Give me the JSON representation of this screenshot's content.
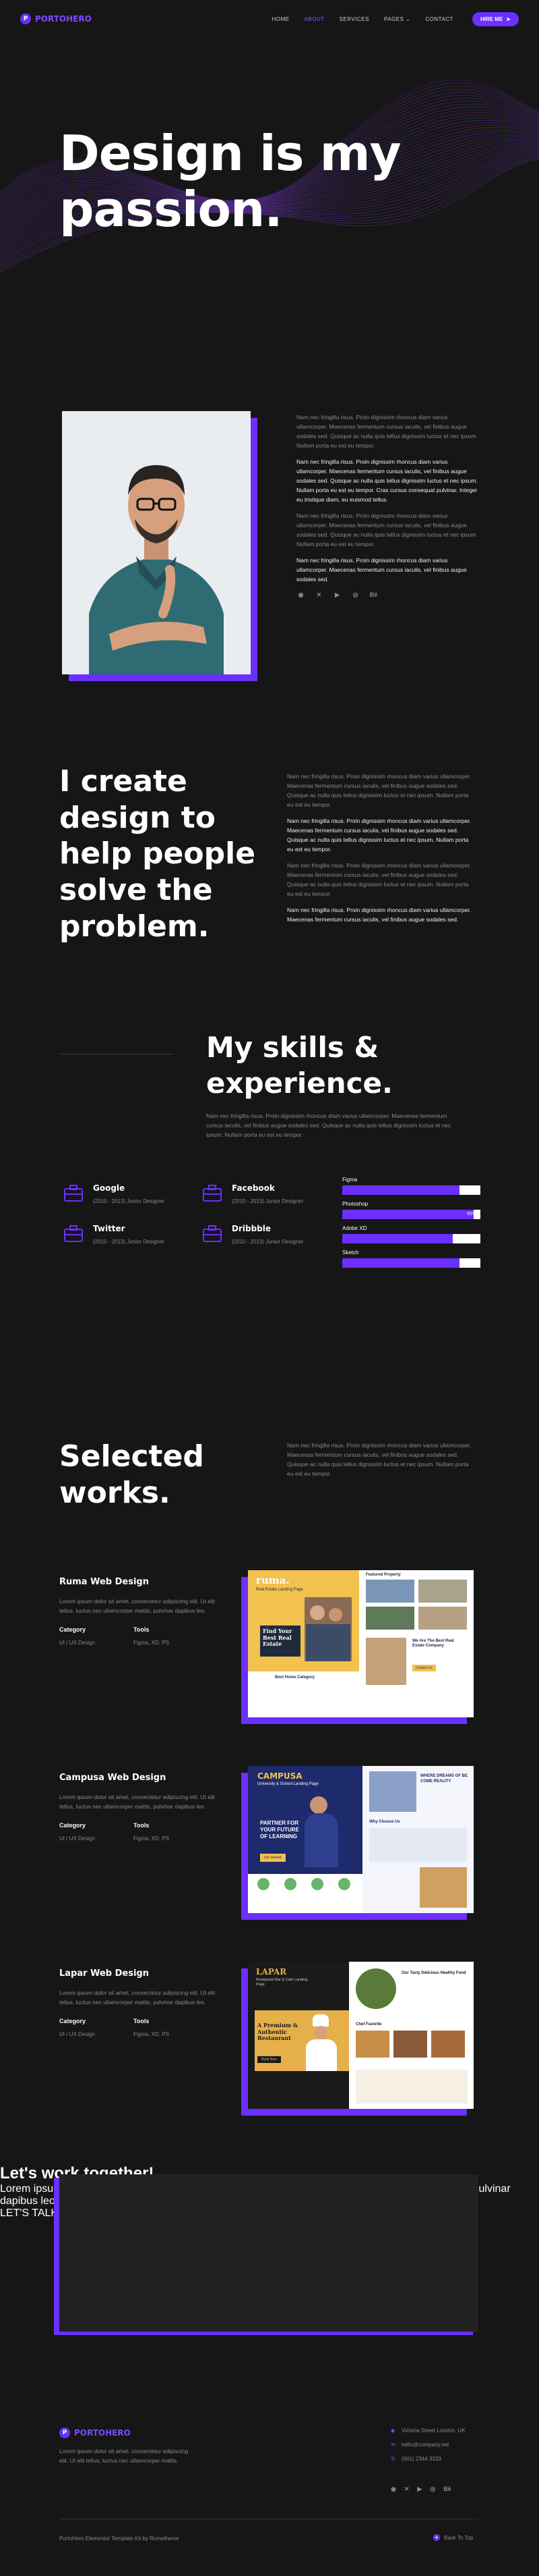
{
  "brand": {
    "name": "PORTOHERO",
    "mark": "P",
    "accent": "#6b2fff"
  },
  "nav": {
    "items": [
      {
        "label": "HOME"
      },
      {
        "label": "ABOUT",
        "active": true
      },
      {
        "label": "SERVICES"
      },
      {
        "label": "PAGES",
        "dropdown": true
      },
      {
        "label": "CONTACT"
      }
    ],
    "cta": "HIRE ME"
  },
  "hero": {
    "title": "Design is my passion."
  },
  "about": {
    "paragraphs": [
      {
        "text": "Nam nec fringilla risus. Proin dignissim rhoncus diam varius ullamcorper. Maecenas fermentum cursus iaculis, vel finibus augue sodales sed. Quisque ac nulla quis tellus dignissim luctus et nec ipsum. Nullam porta eu est eu tempor.",
        "style": "muted"
      },
      {
        "text": "Nam nec fringilla risus. Proin dignissim rhoncus diam varius ullamcorper. Maecenas fermentum cursus iaculis, vel finibus augue sodales sed. Quisque ac nulla quis tellus dignissim luctus et nec ipsum. Nullam porta eu est eu tempor. Cras cursus consequat pulvinar. Integer eu tristique diam, eu euismod tellus.",
        "style": "bright"
      },
      {
        "text": "Nam nec fringilla risus. Proin dignissim rhoncus diam varius ullamcorper. Maecenas fermentum cursus iaculis, vel finibus augue sodales sed. Quisque ac nulla quis tellus dignissim luctus et nec ipsum. Nullam porta eu est eu tempor.",
        "style": "muted"
      },
      {
        "text": "Nam nec fringilla risus. Proin dignissim rhoncus diam varius ullamcorper. Maecenas fermentum cursus iaculis, vel finibus augue sodales sed.",
        "style": "bright"
      }
    ],
    "socials": [
      {
        "icon": "github-icon",
        "glyph": "◉"
      },
      {
        "icon": "twitter-icon",
        "glyph": "✕"
      },
      {
        "icon": "youtube-icon",
        "glyph": "▶"
      },
      {
        "icon": "dribbble-icon",
        "glyph": "◎"
      },
      {
        "icon": "behance-icon",
        "glyph": "Bē"
      }
    ]
  },
  "create": {
    "title": "I create design to help people solve the problem.",
    "paragraphs": [
      {
        "text": "Nam nec fringilla risus. Proin dignissim rhoncus diam varius ullamcorper. Maecenas fermentum cursus iaculis, vel finibus augue sodales sed. Quisque ac nulla quis tellus dignissim luctus et nec ipsum. Nullam porta eu est eu tempor.",
        "style": "muted"
      },
      {
        "text": "Nam nec fringilla risus. Proin dignissim rhoncus diam varius ullamcorper. Maecenas fermentum cursus iaculis, vel finibus augue sodales sed. Quisque ac nulla quis tellus dignissim luctus et nec ipsum. Nullam porta eu est eu tempor.",
        "style": "bright"
      },
      {
        "text": "Nam nec fringilla risus. Proin dignissim rhoncus diam varius ullamcorper. Maecenas fermentum cursus iaculis, vel finibus augue sodales sed. Quisque ac nulla quis tellus dignissim luctus et nec ipsum. Nullam porta eu est eu tempor.",
        "style": "muted"
      },
      {
        "text": "Nam nec fringilla risus. Proin dignissim rhoncus diam varius ullamcorper. Maecenas fermentum cursus iaculis, vel finibus augue sodales sed.",
        "style": "bright"
      }
    ]
  },
  "skills": {
    "title": "My skills & experience.",
    "description": "Nam nec fringilla risus. Proin dignissim rhoncus diam varius ullamcorper. Maecenas fermentum cursus iaculis, vel finibus augue sodales sed. Quisque ac nulla quis tellus dignissim luctus et nec ipsum. Nullam porta eu est eu tempor.",
    "experience": [
      {
        "company": "Google",
        "meta": "(2010 - 2013) Junior Designer"
      },
      {
        "company": "Facebook",
        "meta": "(2010 - 2013) Junior Designer"
      },
      {
        "company": "Twitter",
        "meta": "(2010 - 2013) Junior Designer"
      },
      {
        "company": "Dribbble",
        "meta": "(2010 - 2013) Junior Designer"
      }
    ],
    "bars": [
      {
        "label": "Figma",
        "value": 85,
        "text": "85%"
      },
      {
        "label": "Photoshop",
        "value": 95,
        "text": "95%"
      },
      {
        "label": "Adobe XD",
        "value": 80,
        "text": "80%"
      },
      {
        "label": "Sketch",
        "value": 85,
        "text": "85%"
      }
    ]
  },
  "works": {
    "title": "Selected works.",
    "description": "Nam nec fringilla risus. Proin dignissim rhoncus diam varius ullamcorper. Maecenas fermentum cursus iaculis, vel finibus augue sodales sed. Quisque ac nulla quis tellus dignissim luctus et nec ipsum. Nullam porta eu est eu tempor.",
    "category_label": "Category",
    "tools_label": "Tools",
    "projects": [
      {
        "title": "Ruma Web Design",
        "description": "Lorem ipsum dolor sit amet, consectetur adipiscing elit. Ut elit tellus, luctus nec ullamcorper mattis, pulvinar dapibus leo.",
        "category": "UI / UX Design",
        "tools": "Figma, XD, PS",
        "shot": {
          "brand": "ruma.",
          "tagline": "Real Estate Landing Page",
          "headline": "Find Your Best Real Estate",
          "section": "Featured Property",
          "side": "We Are The Best Real Estate Company",
          "cta": "Contact Us",
          "footer": "Best Home Category"
        }
      },
      {
        "title": "Campusa Web Design",
        "description": "Lorem ipsum dolor sit amet, consectetur adipiscing elit. Ut elit tellus, luctus nec ullamcorper mattis, pulvinar dapibus leo.",
        "category": "UI / UX Design",
        "tools": "Figma, XD, PS",
        "shot": {
          "brand": "CAMPUSA",
          "tagline": "University & School Landing Page",
          "headline": "PARTNER FOR YOUR FUTURE OF LEARNING",
          "side": "WHERE DREAMS OF BE COME REALITY",
          "section": "Why Choose Us",
          "cta": "Get Started"
        }
      },
      {
        "title": "Lapar Web Design",
        "description": "Lorem ipsum dolor sit amet, consectetur adipiscing elit. Ut elit tellus, luctus nec ullamcorper mattis, pulvinar dapibus leo.",
        "category": "UI / UX Design",
        "tools": "Figma, XD, PS",
        "shot": {
          "brand": "LAPAR",
          "tagline": "Restaurant Bar & Cafe Landing Page",
          "headline": "A Premium & Authentic Restaurant",
          "side": "Our Tasty Delicious Healthy Food",
          "section": "Chef Favorite",
          "cta": "Book Now"
        }
      }
    ]
  },
  "cta": {
    "title": "Let's work together!",
    "text": "Lorem ipsum dolor sit amet, consectetur adipiscing elit. Ut elit tellus, luctus nec ullamcorper mattis, pulvinar dapibus leo.",
    "button": "LET'S TALK"
  },
  "footer": {
    "description": "Lorem ipsum dolor sit amet, consectetur adipiscing elit. Ut elit tellus, luctus nec ullamcorper mattis.",
    "contacts": [
      {
        "icon": "location-icon",
        "glyph": "◆",
        "text": "Victoria Street London, UK"
      },
      {
        "icon": "mail-icon",
        "glyph": "✉",
        "text": "hello@company.net"
      },
      {
        "icon": "phone-icon",
        "glyph": "✆",
        "text": "(001) 2344 3333"
      }
    ],
    "socials": [
      {
        "icon": "github-icon",
        "glyph": "◉"
      },
      {
        "icon": "twitter-icon",
        "glyph": "✕"
      },
      {
        "icon": "youtube-icon",
        "glyph": "▶"
      },
      {
        "icon": "dribbble-icon",
        "glyph": "◎"
      },
      {
        "icon": "behance-icon",
        "glyph": "Bē"
      }
    ],
    "copyright": "PortoHero Elementor Template Kit by Rometheme",
    "back_to_top": "Back To Top"
  }
}
